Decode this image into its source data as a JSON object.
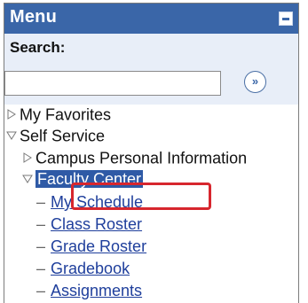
{
  "menu": {
    "title": "Menu",
    "collapse_icon": "minus-icon"
  },
  "search": {
    "label": "Search:",
    "value": "",
    "placeholder": "",
    "go_symbol": "»"
  },
  "tree": {
    "my_favorites": "My Favorites",
    "self_service": "Self Service",
    "campus_personal_information": "Campus Personal Information",
    "faculty_center": "Faculty Center",
    "items": [
      {
        "label": "My Schedule"
      },
      {
        "label": "Class Roster"
      },
      {
        "label": "Grade Roster"
      },
      {
        "label": "Gradebook"
      },
      {
        "label": "Assignments"
      }
    ]
  },
  "colors": {
    "header_bg": "#3a66a8",
    "search_bg": "#e8eef8",
    "selected_bg": "#2f5aa6",
    "link": "#1f3f9c",
    "highlight_border": "#d7262e"
  }
}
